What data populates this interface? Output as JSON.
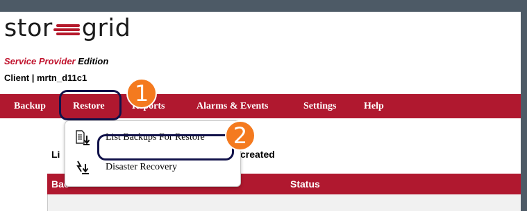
{
  "brand": {
    "logo_left": "stor",
    "logo_right": "grid",
    "edition_highlight": "Service Provider",
    "edition_suffix": "Edition",
    "client_label": "Client | mrtn_d11c1"
  },
  "nav": {
    "items": [
      "Backup",
      "Restore",
      "Reports",
      "Alarms & Events",
      "Settings",
      "Help"
    ],
    "active": "Restore"
  },
  "dropdown": {
    "items": [
      {
        "label": "List Backups For Restore",
        "icon": "list-restore-icon"
      },
      {
        "label": "Disaster Recovery",
        "icon": "disaster-recovery-icon"
      }
    ]
  },
  "callouts": [
    "1",
    "2"
  ],
  "content": {
    "title_left": "Li",
    "title_right": "created",
    "table_headers": [
      "Bac",
      "Status"
    ]
  },
  "colors": {
    "nav_bg": "#b0182f",
    "callout": "#f47a1f",
    "highlight_border": "#11124a",
    "frame": "#4d5a66"
  }
}
